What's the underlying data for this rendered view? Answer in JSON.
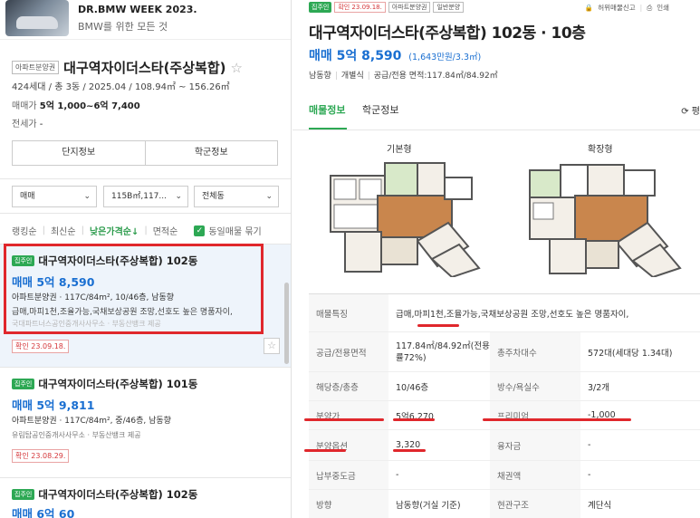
{
  "ad": {
    "title": "DR.BMW WEEK 2023.",
    "subtitle": "BMW를 위한 모든 것"
  },
  "complex": {
    "tag": "아파트분양권",
    "name": "대구역자이더스타(주상복합)",
    "info": "424세대 / 총 3동 / 2025.04 / 108.94㎡ ~ 156.26㎡",
    "price_label": "매매가",
    "price_value": "5억 1,000~6억 7,400",
    "rent_label": "전세가",
    "rent_value": "-",
    "buttons": [
      "단지정보",
      "학군정보"
    ]
  },
  "filters": [
    {
      "label": "매매"
    },
    {
      "label": "115B㎡,117..."
    },
    {
      "label": "전체동"
    }
  ],
  "sort": {
    "options": [
      "랭킹순",
      "최신순",
      "낮은가격순↓",
      "면적순"
    ],
    "active_index": 2,
    "checkbox_label": "동일매물 묶기",
    "checkbox_checked": true
  },
  "listings": [
    {
      "badge": "집주인",
      "name": "대구역자이더스타(주상복합) 102동",
      "price": "매매 5억 8,590",
      "spec": "아파트분양권 · 117C/84m², 10/46층, 남동향",
      "desc": "급매,마피1천,조율가능,국채보상공원 조망,선호도 높은 명품자이,",
      "agent": "국대파트너스공인중개사사무소 · 부동산뱅크 제공",
      "confirm": "확인 23.09.18.",
      "selected": true
    },
    {
      "badge": "집주인",
      "name": "대구역자이더스타(주상복합) 101동",
      "price": "매매 5억 9,811",
      "spec": "아파트분양권 · 117C/84m², 중/46층, 남동향",
      "desc": "",
      "agent": "유림탑공인중개사사무소 · 부동산뱅크 제공",
      "confirm": "확인 23.08.29.",
      "selected": false
    },
    {
      "badge": "집주인",
      "name": "대구역자이더스타(주상복합) 102동",
      "price": "매매 6억 60",
      "spec": "",
      "desc": "",
      "agent": "",
      "confirm": "",
      "selected": false
    }
  ],
  "detail": {
    "tags": {
      "owner": "집주인",
      "confirm": "확인 23.09.18.",
      "type": "아파트분양권",
      "sale": "일반분양"
    },
    "actions": {
      "report": "허위매물신고",
      "print": "인쇄"
    },
    "title": "대구역자이더스타(주상복합) 102동 · 10층",
    "price": "매매 5억 8,590",
    "price_per": "(1,643만원/3.3㎡)",
    "spec": {
      "direction": "남동향",
      "heating": "개별식",
      "area": "공급/전용 면적:117.84㎡/84.92㎡"
    },
    "tabs": [
      "매물정보",
      "학군정보"
    ],
    "refresh_label": "⟳ 평",
    "plans": [
      "기본형",
      "확장형"
    ],
    "table": [
      {
        "k1": "매물특징",
        "v1": "급매,마피1천,조율가능,국채보상공원 조망,선호도 높은 명품자이,"
      },
      {
        "k1": "공급/전용면적",
        "v1": "117.84㎡/84.92㎡(전용률72%)",
        "k2": "총주차대수",
        "v2": "572대(세대당 1.34대)"
      },
      {
        "k1": "해당층/총층",
        "v1": "10/46층",
        "k2": "방수/욕실수",
        "v2": "3/2개"
      },
      {
        "k1": "분양가",
        "v1": "5억6,270",
        "k2": "프리미엄",
        "v2": "-1,000"
      },
      {
        "k1": "분양옵션",
        "v1": "3,320",
        "k2": "융자금",
        "v2": "-"
      },
      {
        "k1": "납부중도금",
        "v1": "-",
        "k2": "채권액",
        "v2": "-"
      },
      {
        "k1": "방향",
        "v1": "남동향(거실 기준)",
        "k2": "현관구조",
        "v2": "계단식"
      }
    ]
  },
  "colors": {
    "accent_green": "#2da854",
    "price_blue": "#1a6fd1",
    "highlight_red": "#e0272c"
  }
}
